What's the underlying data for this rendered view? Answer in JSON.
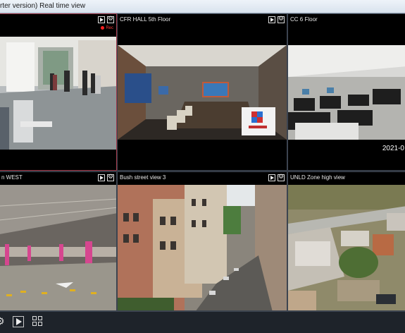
{
  "window": {
    "title": "rter version) Real time view"
  },
  "cameras": [
    {
      "name": "",
      "recording": true,
      "rec_label": "Rec"
    },
    {
      "name": "CFR HALL 5th Floor"
    },
    {
      "name": "CC 6 Floor",
      "timestamp": "2021-0"
    },
    {
      "name": "n WEST"
    },
    {
      "name": "Bush street view 3"
    },
    {
      "name": "UNLD Zone high view"
    }
  ],
  "toolbar": {
    "buttons": [
      "settings-icon",
      "play-icon",
      "grid-layout-icon"
    ]
  },
  "colors": {
    "active_border": "#a33a4a",
    "rec": "#ff2020",
    "background": "#1a1f26"
  }
}
